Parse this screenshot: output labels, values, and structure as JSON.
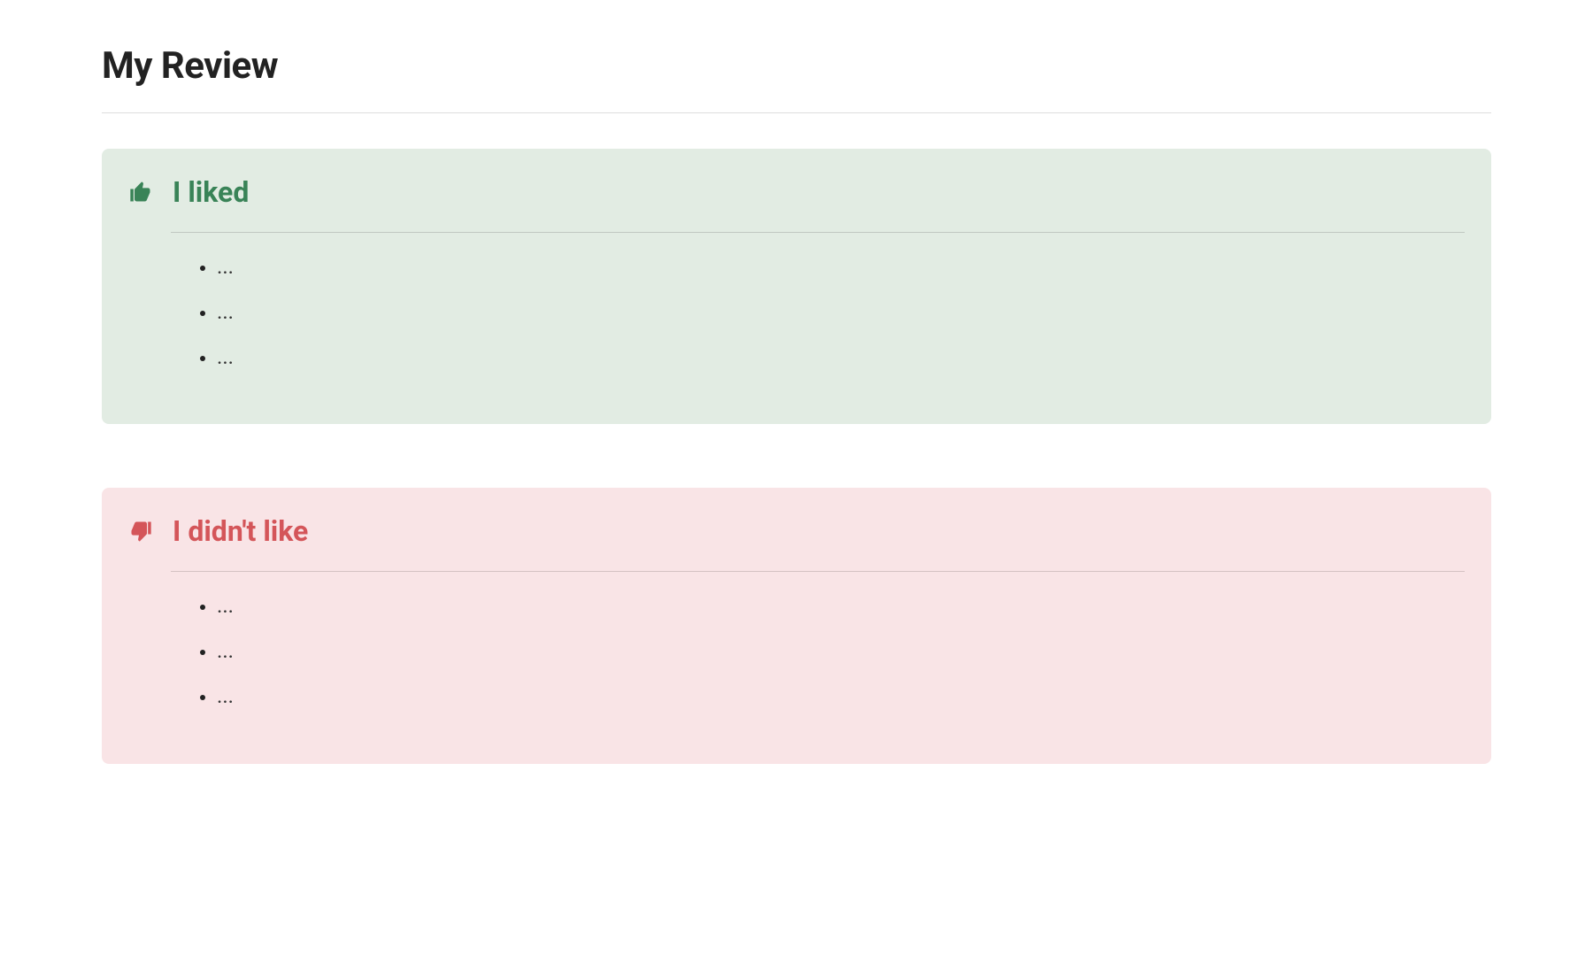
{
  "page": {
    "title": "My Review"
  },
  "liked": {
    "heading": "I liked",
    "items": [
      "...",
      "...",
      "..."
    ]
  },
  "disliked": {
    "heading": "I didn't like",
    "items": [
      "...",
      "...",
      "..."
    ]
  }
}
